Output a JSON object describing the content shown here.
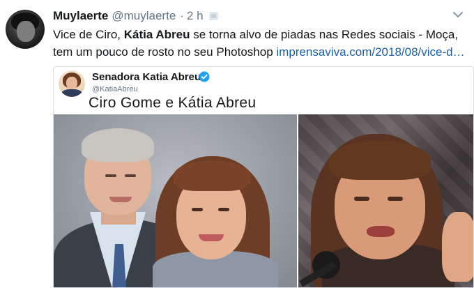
{
  "tweet": {
    "author_name": "Muylaerte",
    "author_handle": "@muylaerte",
    "separator": "·",
    "time": "2 h",
    "text_part1": "Vice de Ciro, ",
    "text_bold": "Kátia Abreu",
    "text_part2": " se torna alvo de piadas nas Redes sociais - Moça, tem um pouco de rosto no seu Photoshop ",
    "link_text": "imprensaviva.com/2018/08/vice-d…"
  },
  "embedded": {
    "name": "Senadora Katia Abreu",
    "handle": "@KatiaAbreu",
    "title": "Ciro Gome e Kátia Abreu"
  },
  "colors": {
    "link": "#1b5ea8",
    "verified": "#1da1f2",
    "secondary_text": "#657786"
  },
  "icons": {
    "menu": "chevron-down-icon",
    "verified": "verified-badge-icon"
  }
}
